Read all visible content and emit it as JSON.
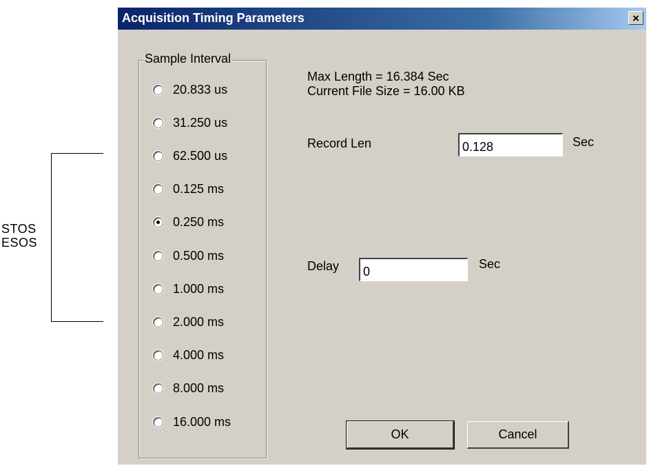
{
  "annotation": {
    "lines": [
      "STOS",
      "ESOS"
    ]
  },
  "dialog": {
    "title": "Acquisition Timing Parameters",
    "close_label": "×",
    "sample_interval": {
      "label": "Sample Interval",
      "selected": "0.250 ms",
      "options": [
        "20.833 us",
        "31.250 us",
        "62.500 us",
        "0.125 ms",
        "0.250 ms",
        "0.500 ms",
        "1.000 ms",
        "2.000 ms",
        "4.000 ms",
        "8.000 ms",
        "16.000 ms"
      ]
    },
    "info": {
      "max_length": "Max Length = 16.384 Sec",
      "file_size": "Current File Size = 16.00 KB"
    },
    "record_len": {
      "label": "Record Len",
      "value": "0.128",
      "unit": "Sec"
    },
    "delay": {
      "label": "Delay",
      "value": "0",
      "unit": "Sec"
    },
    "buttons": {
      "ok": "OK",
      "cancel": "Cancel"
    }
  }
}
